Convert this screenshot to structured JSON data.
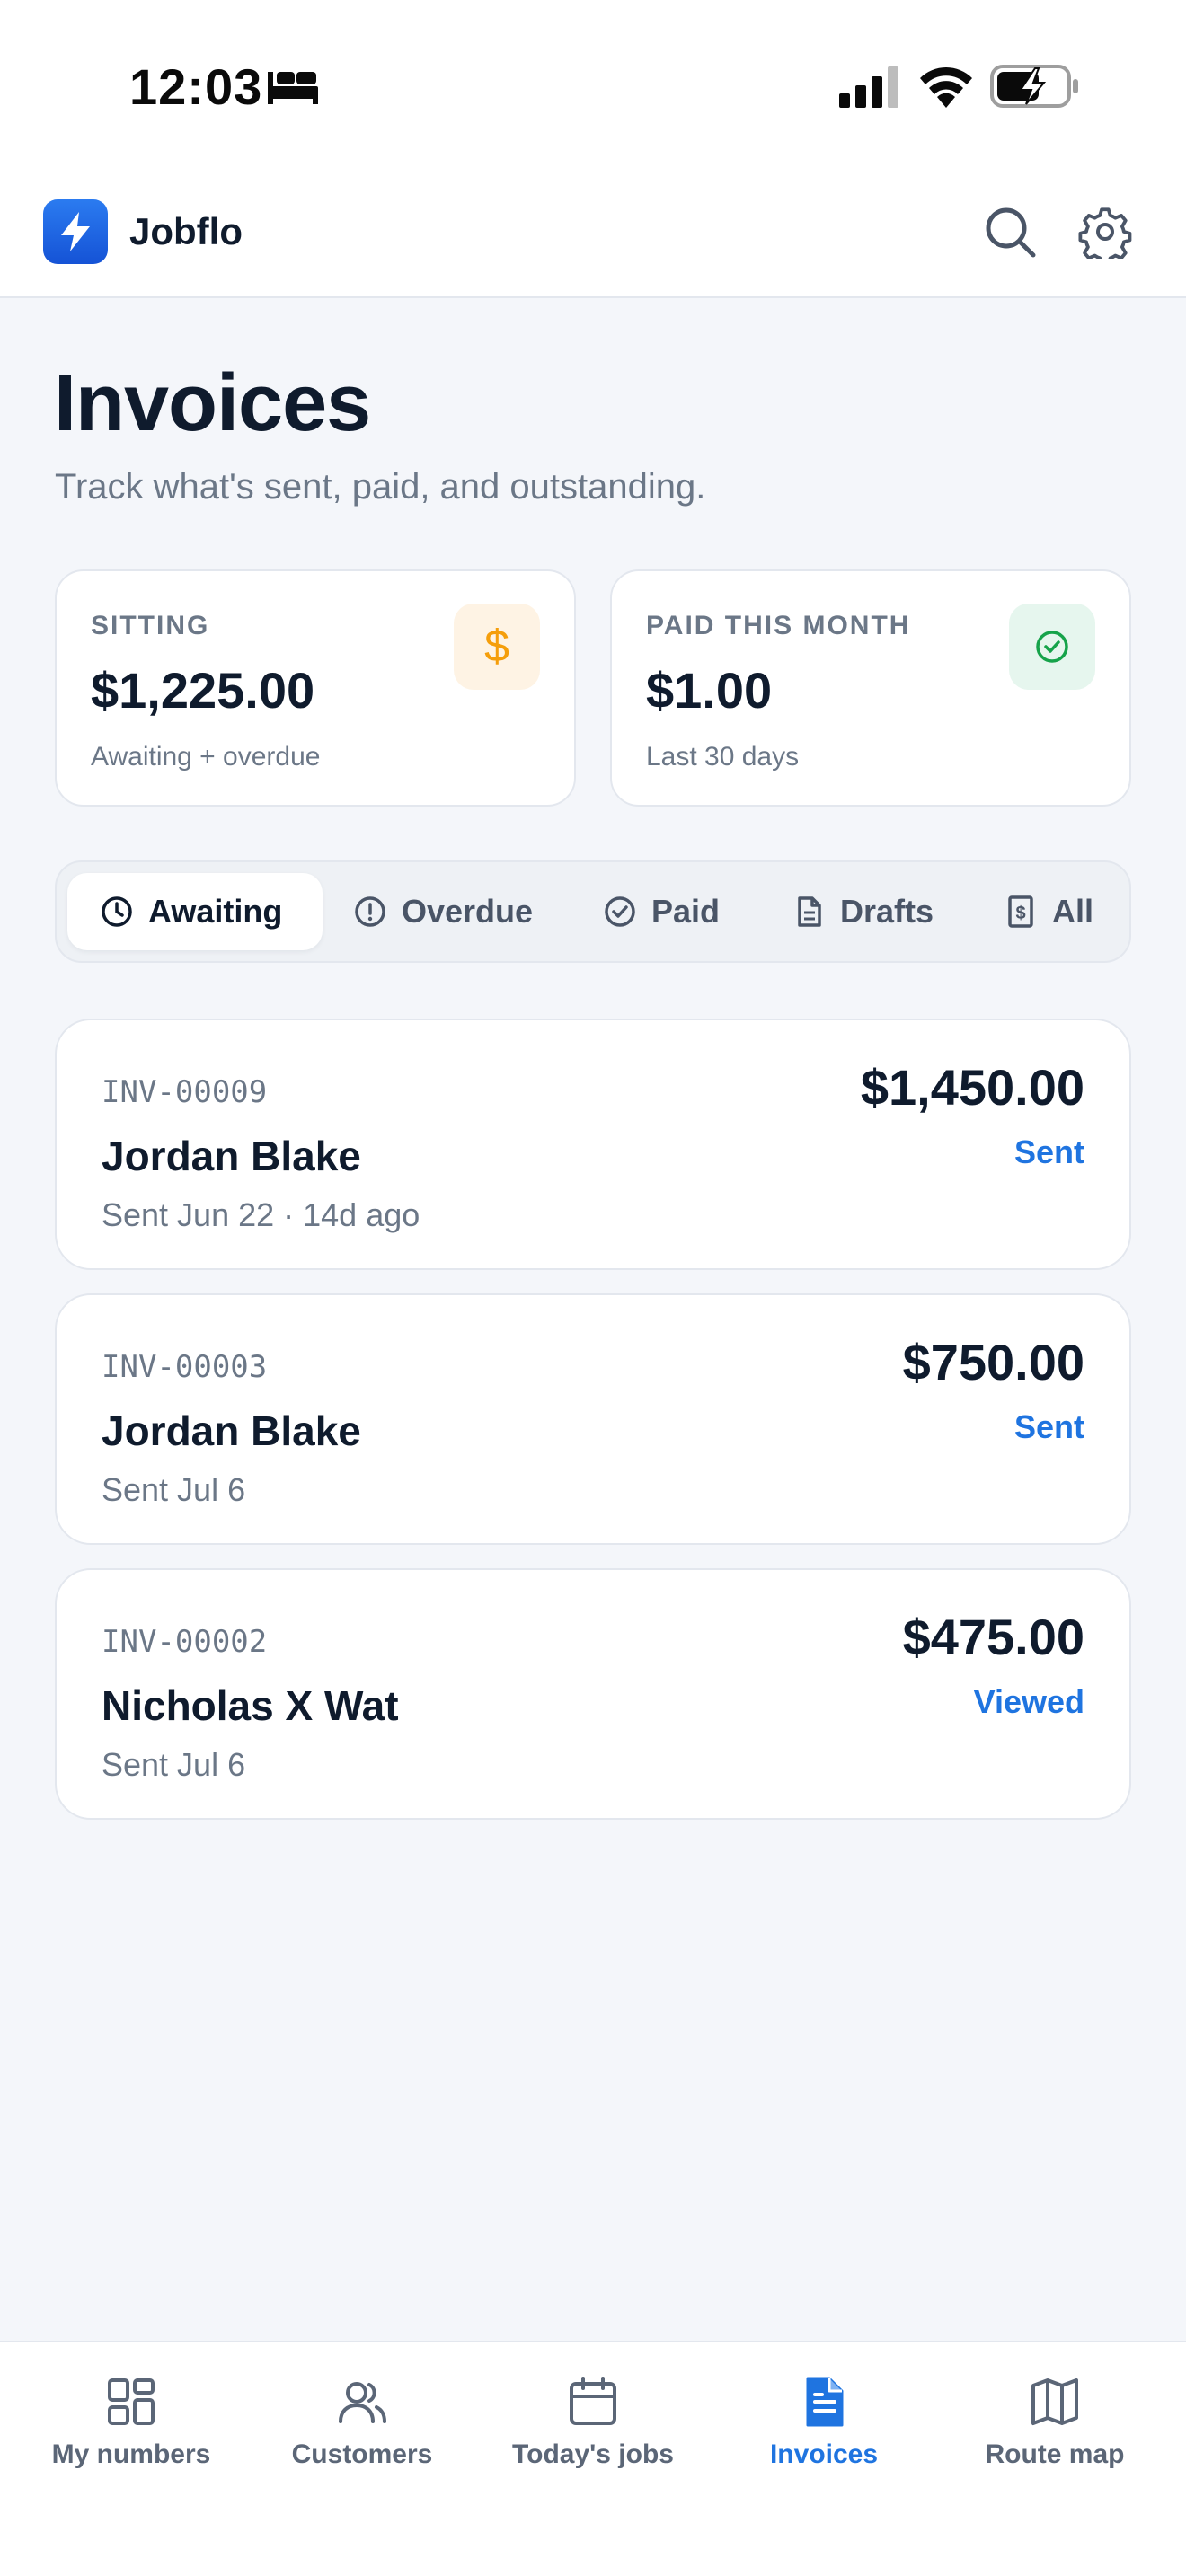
{
  "status_bar": {
    "time": "12:03"
  },
  "app": {
    "name": "Jobflo",
    "brand_color": "#1F74E0"
  },
  "page": {
    "title": "Invoices",
    "subtitle": "Track what's sent, paid, and outstanding."
  },
  "stats": {
    "sitting": {
      "label": "SITTING",
      "value": "$1,225.00",
      "note": "Awaiting + overdue",
      "badge_symbol": "$"
    },
    "paid": {
      "label": "PAID THIS MONTH",
      "value": "$1.00",
      "note": "Last 30 days",
      "icon": "check-circle-icon"
    }
  },
  "filters": [
    {
      "label": "Awaiting",
      "icon": "clock-icon",
      "active": true
    },
    {
      "label": "Overdue",
      "icon": "alert-circle-icon",
      "active": false
    },
    {
      "label": "Paid",
      "icon": "check-circle-icon",
      "active": false
    },
    {
      "label": "Drafts",
      "icon": "document-icon",
      "active": false
    },
    {
      "label": "All",
      "icon": "receipt-icon",
      "active": false
    }
  ],
  "invoices": [
    {
      "number": "INV-00009",
      "customer": "Jordan Blake",
      "sent": "Sent Jun 22  · 14d ago",
      "amount": "$1,450.00",
      "status": "Sent"
    },
    {
      "number": "INV-00003",
      "customer": "Jordan Blake",
      "sent": "Sent Jul 6",
      "amount": "$750.00",
      "status": "Sent"
    },
    {
      "number": "INV-00002",
      "customer": "Nicholas X Wat",
      "sent": "Sent Jul 6",
      "amount": "$475.00",
      "status": "Viewed"
    }
  ],
  "tabs": [
    {
      "label": "My numbers",
      "icon": "dashboard-icon",
      "active": false
    },
    {
      "label": "Customers",
      "icon": "users-icon",
      "active": false
    },
    {
      "label": "Today's jobs",
      "icon": "calendar-icon",
      "active": false
    },
    {
      "label": "Invoices",
      "icon": "invoice-icon",
      "active": true
    },
    {
      "label": "Route map",
      "icon": "map-icon",
      "active": false
    }
  ]
}
